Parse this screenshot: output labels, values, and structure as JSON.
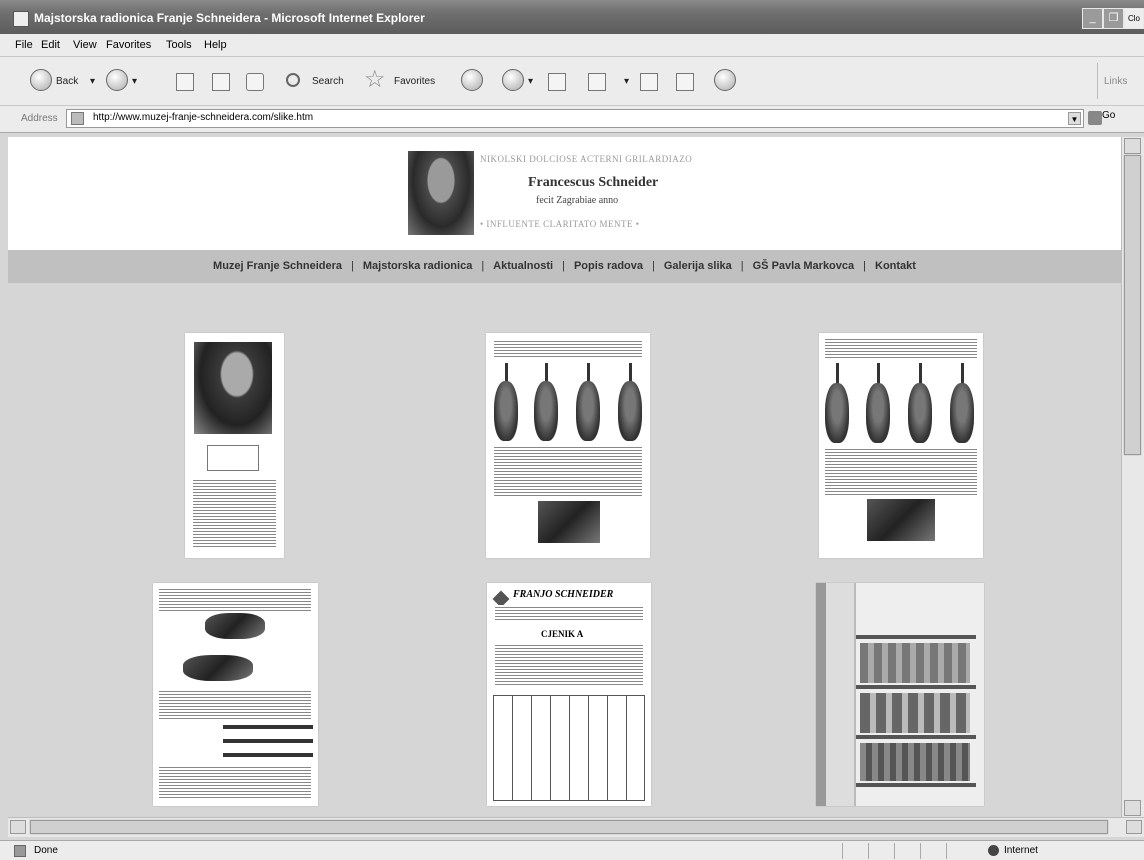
{
  "window": {
    "title": "Majstorska radionica Franje Schneidera - Microsoft Internet Explorer",
    "close_tooltip": "Clo"
  },
  "menu": [
    "File",
    "Edit",
    "View",
    "Favorites",
    "Tools",
    "Help"
  ],
  "toolbar": {
    "back_label": "Back",
    "search_label": "Search",
    "favorites_label": "Favorites",
    "links_label": "Links"
  },
  "address": {
    "label": "Address",
    "url": "http://www.muzej-franje-schneidera.com/slike.htm",
    "go_label": "Go"
  },
  "page": {
    "logo": {
      "seal_top": "NIKOLSKI DOLCIOSE ACTERNI GRILARDIAZO",
      "name": "Francescus Schneider",
      "subtitle": "fecit Zagrabiae anno",
      "seal_bottom": "• INFLUENTE CLARITATO MENTE •"
    },
    "nav": [
      "Muzej Franje Schneidera",
      "Majstorska radionica",
      "Aktualnosti",
      "Popis radova",
      "Galerija slika",
      "GŠ Pavla Markovca",
      "Kontakt"
    ],
    "thumbs": [
      {
        "kind": "portrait"
      },
      {
        "kind": "violin-catalog"
      },
      {
        "kind": "violin-catalog"
      },
      {
        "kind": "bow-catalog"
      },
      {
        "kind": "price-list",
        "heading": "FRANJO SCHNEIDER",
        "subheading": "CJENIK A"
      },
      {
        "kind": "workshop-photo"
      }
    ]
  },
  "status": {
    "text": "Done",
    "zone": "Internet"
  }
}
